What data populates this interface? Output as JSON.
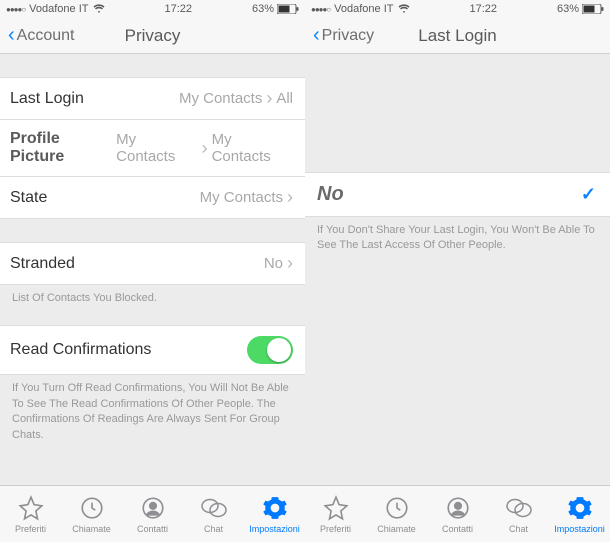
{
  "status": {
    "carrier": "Vodafone IT",
    "time": "17:22",
    "battery": "63%"
  },
  "left": {
    "nav": {
      "back": "Account",
      "title": "Privacy"
    },
    "rows": {
      "last_login": {
        "label": "Last Login",
        "value": "My Contacts",
        "extra": "All"
      },
      "profile_pic": {
        "label": "Profile Picture",
        "value": "My Contacts",
        "extra": "My Contacts"
      },
      "state": {
        "label": "State",
        "value": "My Contacts"
      },
      "stranded": {
        "label": "Stranded",
        "value": "No"
      },
      "read_conf": {
        "label": "Read Confirmations"
      }
    },
    "help": {
      "blocked": "List Of Contacts You Blocked.",
      "read_conf": "If You Turn Off Read Confirmations, You Will Not Be Able To See The Read Confirmations Of Other People. The Confirmations Of Readings Are Always Sent For Group Chats."
    }
  },
  "right": {
    "nav": {
      "back": "Privacy",
      "title": "Last Login"
    },
    "option": {
      "label": "No"
    },
    "help": "If You Don't Share Your Last Login, You Won't Be Able To See The Last Access Of Other People."
  },
  "tabs": {
    "preferiti": "Preferiti",
    "chiamate": "Chiamate",
    "contatti": "Contatti",
    "chat": "Chat",
    "impostazioni": "Impostazioni"
  }
}
